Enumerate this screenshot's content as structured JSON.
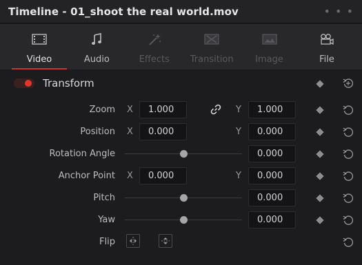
{
  "window": {
    "title": "Timeline - 01_shoot the real world.mov",
    "more_glyph": "• • •"
  },
  "tabs": [
    {
      "label": "Video",
      "icon": "film-icon",
      "state": "active"
    },
    {
      "label": "Audio",
      "icon": "music-note-icon",
      "state": "enabled"
    },
    {
      "label": "Effects",
      "icon": "magic-wand-icon",
      "state": "disabled"
    },
    {
      "label": "Transition",
      "icon": "transition-icon",
      "state": "disabled"
    },
    {
      "label": "Image",
      "icon": "image-icon",
      "state": "disabled"
    },
    {
      "label": "File",
      "icon": "file-icon",
      "state": "enabled"
    }
  ],
  "transform": {
    "title": "Transform",
    "enabled": true,
    "accent_color": "#e2362b",
    "zoom": {
      "label": "Zoom",
      "x_axis": "X",
      "x_value": "1.000",
      "y_axis": "Y",
      "y_value": "1.000",
      "linked": true
    },
    "position": {
      "label": "Position",
      "x_axis": "X",
      "x_value": "0.000",
      "y_axis": "Y",
      "y_value": "0.000"
    },
    "rotation_angle": {
      "label": "Rotation Angle",
      "value": "0.000",
      "slider_fraction": 0.5
    },
    "anchor_point": {
      "label": "Anchor Point",
      "x_axis": "X",
      "x_value": "0.000",
      "y_axis": "Y",
      "y_value": "0.000"
    },
    "pitch": {
      "label": "Pitch",
      "value": "0.000",
      "slider_fraction": 0.5
    },
    "yaw": {
      "label": "Yaw",
      "value": "0.000",
      "slider_fraction": 0.5
    },
    "flip": {
      "label": "Flip"
    }
  }
}
